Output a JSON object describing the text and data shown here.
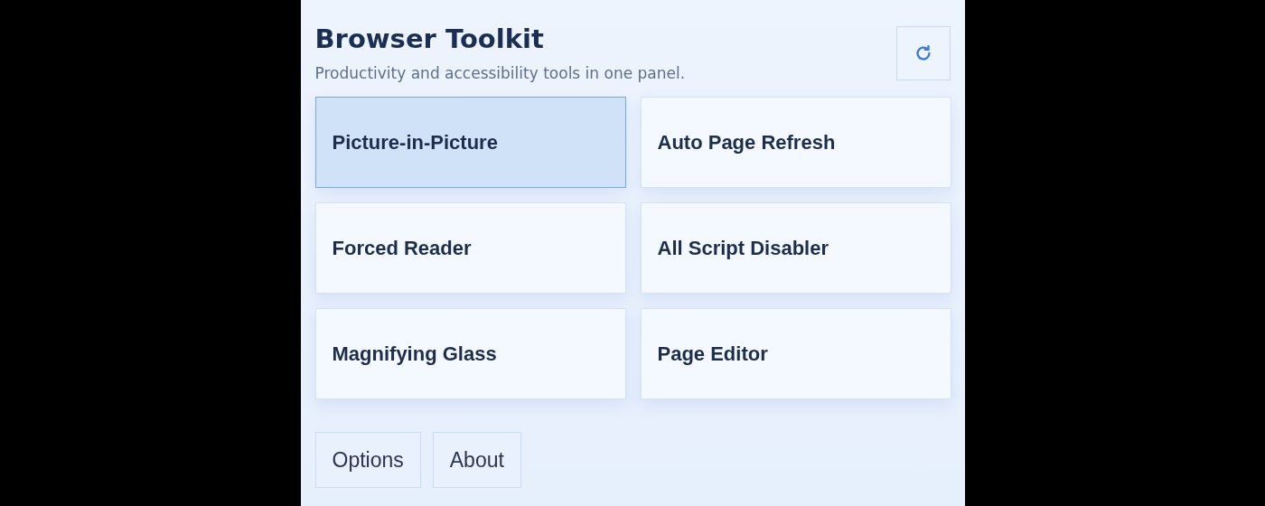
{
  "header": {
    "title": "Browser Toolkit",
    "subtitle": "Productivity and accessibility tools in one panel."
  },
  "tools": [
    {
      "label": "Picture-in-Picture",
      "selected": true
    },
    {
      "label": "Auto Page Refresh",
      "selected": false
    },
    {
      "label": "Forced Reader",
      "selected": false
    },
    {
      "label": "All Script Disabler",
      "selected": false
    },
    {
      "label": "Magnifying Glass",
      "selected": false
    },
    {
      "label": "Page Editor",
      "selected": false
    }
  ],
  "footer_buttons": [
    "Options",
    "About"
  ]
}
